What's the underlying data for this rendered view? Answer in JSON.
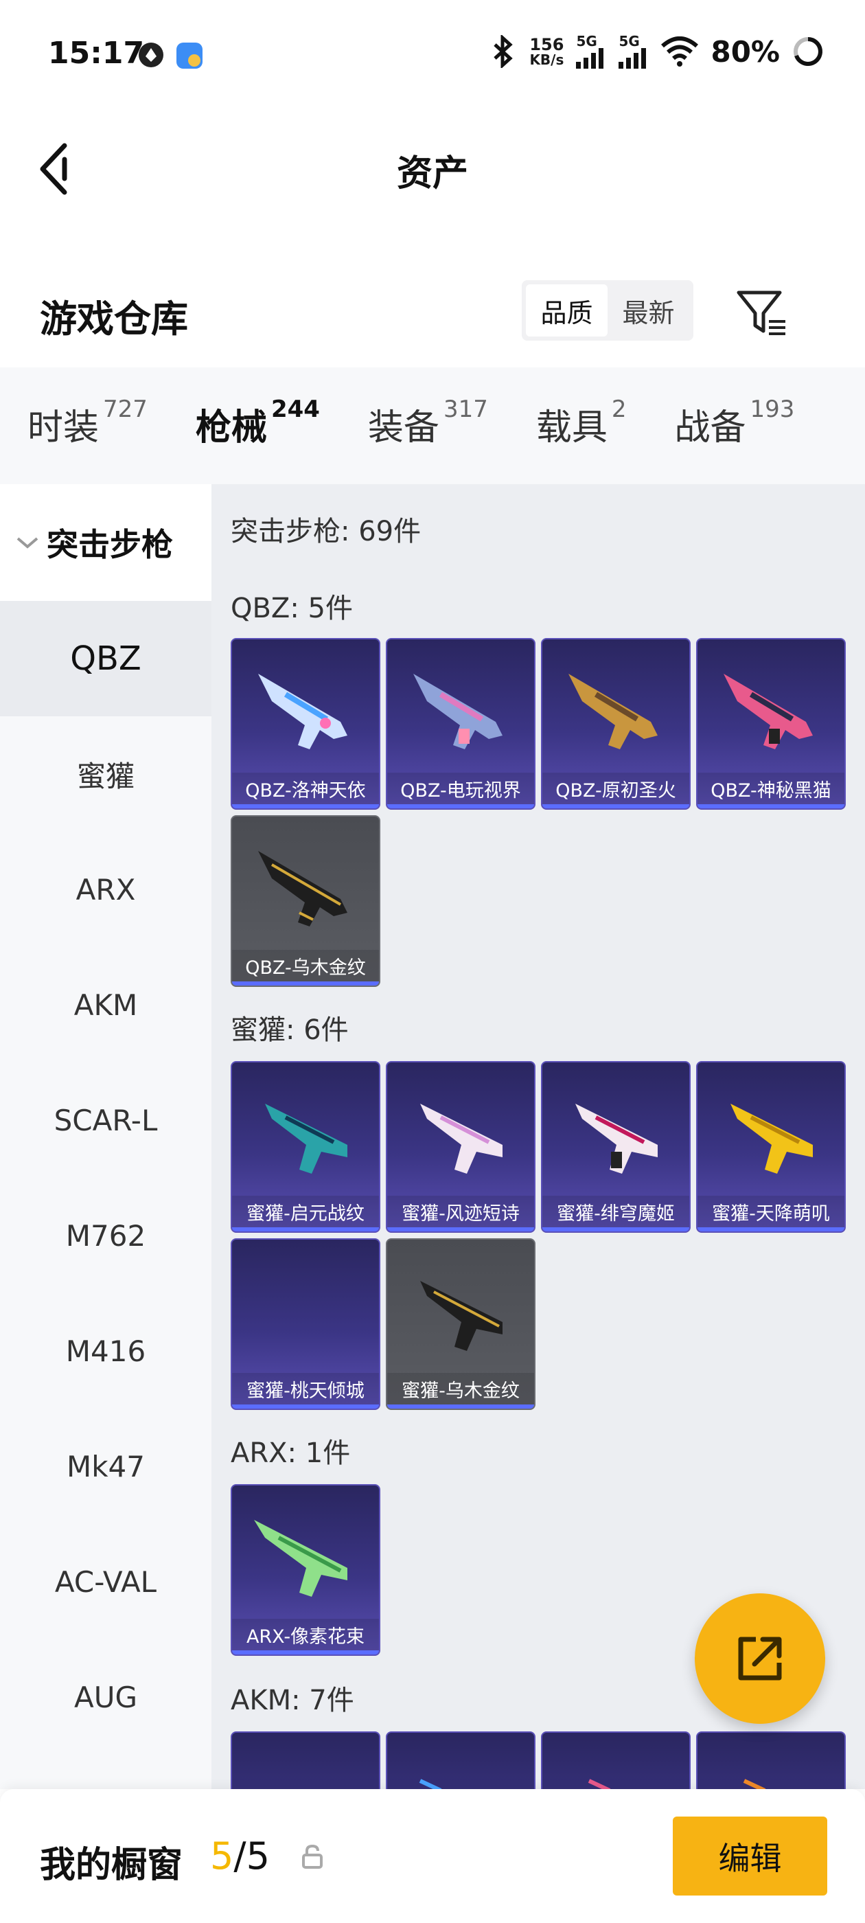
{
  "status_bar": {
    "time": "15:17",
    "net_speed_value": "156",
    "net_speed_unit": "KB/s",
    "sim1": "5G",
    "sim2": "5G",
    "battery": "80%"
  },
  "header": {
    "title": "资产"
  },
  "warehouse": {
    "title": "游戏仓库",
    "sort_options": [
      "品质",
      "最新"
    ],
    "sort_active": "品质"
  },
  "tabs": [
    {
      "label": "时装",
      "count": "727"
    },
    {
      "label": "枪械",
      "count": "244"
    },
    {
      "label": "装备",
      "count": "317"
    },
    {
      "label": "载具",
      "count": "2"
    },
    {
      "label": "战备",
      "count": "193"
    }
  ],
  "sidebar": {
    "group": "突击步枪",
    "items": [
      "QBZ",
      "蜜獾",
      "ARX",
      "AKM",
      "SCAR-L",
      "M762",
      "M416",
      "Mk47",
      "AC-VAL",
      "AUG"
    ],
    "active": "QBZ"
  },
  "main": {
    "total": "突击步枪: 69件",
    "sections": [
      {
        "header": "QBZ: 5件",
        "cards": [
          {
            "label": "QBZ-洛神天依",
            "tier": "purple"
          },
          {
            "label": "QBZ-电玩视界",
            "tier": "purple"
          },
          {
            "label": "QBZ-原初圣火",
            "tier": "purple"
          },
          {
            "label": "QBZ-神秘黑猫",
            "tier": "purple"
          },
          {
            "label": "QBZ-乌木金纹",
            "tier": "grey"
          }
        ]
      },
      {
        "header": "蜜獾: 6件",
        "cards": [
          {
            "label": "蜜獾-启元战纹",
            "tier": "purple"
          },
          {
            "label": "蜜獾-风迹短诗",
            "tier": "purple"
          },
          {
            "label": "蜜獾-绯穹魔姬",
            "tier": "purple"
          },
          {
            "label": "蜜獾-天降萌叽",
            "tier": "purple"
          },
          {
            "label": "蜜獾-桃天倾城",
            "tier": "purple"
          },
          {
            "label": "蜜獾-乌木金纹",
            "tier": "grey"
          }
        ]
      },
      {
        "header": "ARX: 1件",
        "cards": [
          {
            "label": "ARX-像素花束",
            "tier": "purple"
          }
        ]
      },
      {
        "header": "AKM: 7件",
        "cards": []
      }
    ]
  },
  "bottom_bar": {
    "title": "我的橱窗",
    "count_used": "5",
    "count_sep": "/",
    "count_total": "5",
    "edit_label": "编辑"
  },
  "colors": {
    "accent": "#f7b313",
    "card_purple": "#3b3585",
    "card_grey": "#55575d",
    "tab_bg": "#f7f8fa",
    "panel_bg": "#eceef2"
  },
  "icons": {
    "back": "chevron-left-icon",
    "filter": "filter-icon",
    "fab": "share-edit-icon",
    "lock": "lock-icon",
    "collapse": "chevron-down-icon"
  }
}
